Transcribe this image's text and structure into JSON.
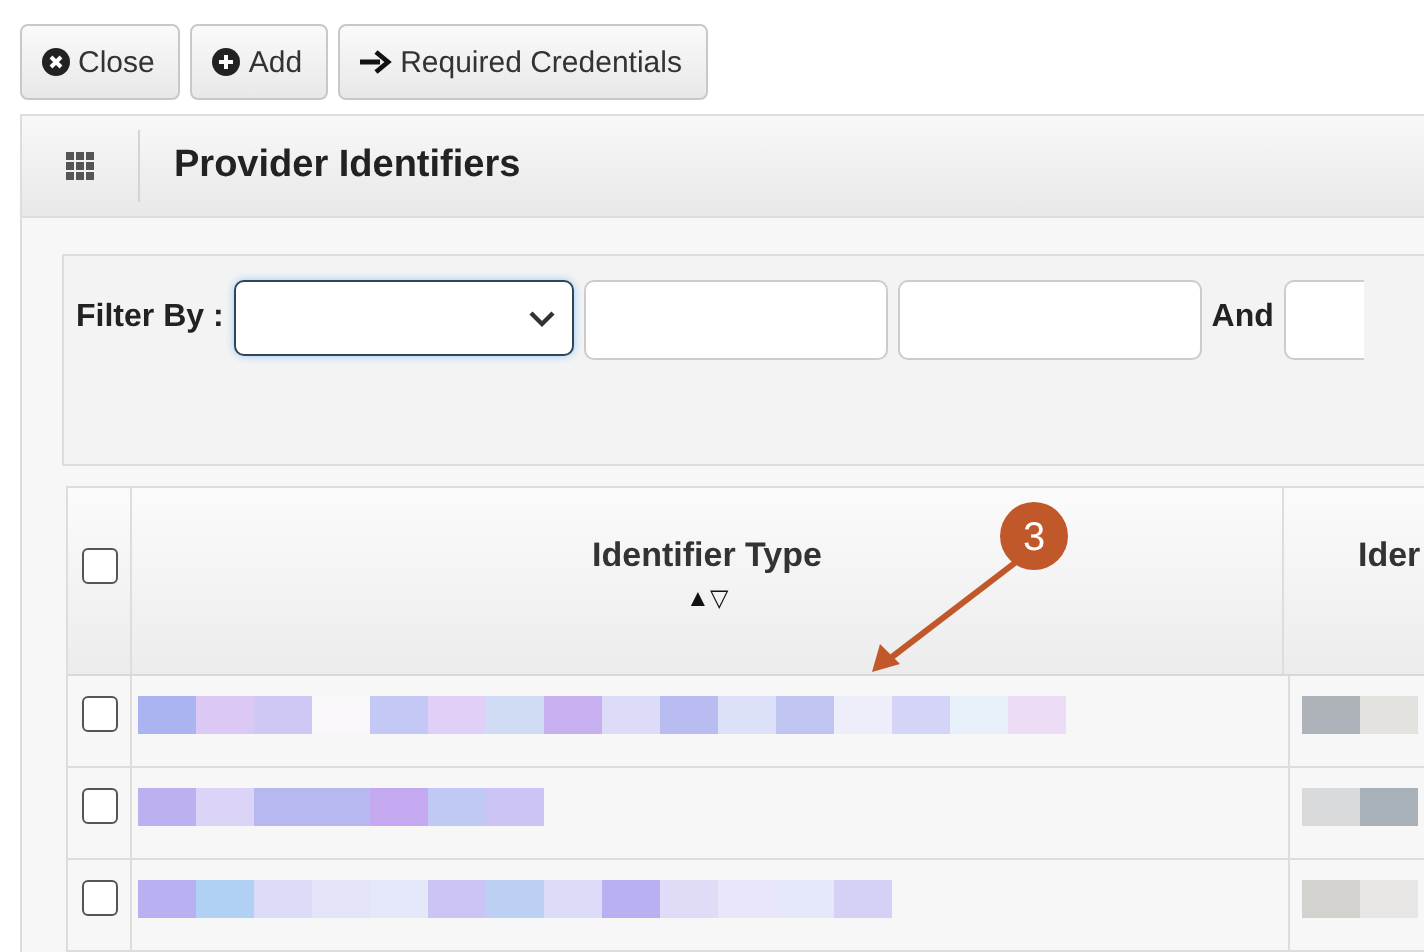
{
  "toolbar": [
    {
      "kind": "close",
      "label": "Close"
    },
    {
      "kind": "add",
      "label": "Add"
    },
    {
      "kind": "arrow",
      "label": "Required Credentials"
    }
  ],
  "panel": {
    "title": "Provider Identifiers"
  },
  "filter": {
    "label": "Filter By :",
    "and_label": "And"
  },
  "table": {
    "select_all_checked": false,
    "columns": [
      {
        "label": "Identifier Type",
        "sort": "▲▽"
      },
      {
        "label": "Ider"
      }
    ],
    "rows": [
      {
        "checked": false
      },
      {
        "checked": false
      },
      {
        "checked": false
      }
    ]
  },
  "callout": {
    "label": "3"
  }
}
